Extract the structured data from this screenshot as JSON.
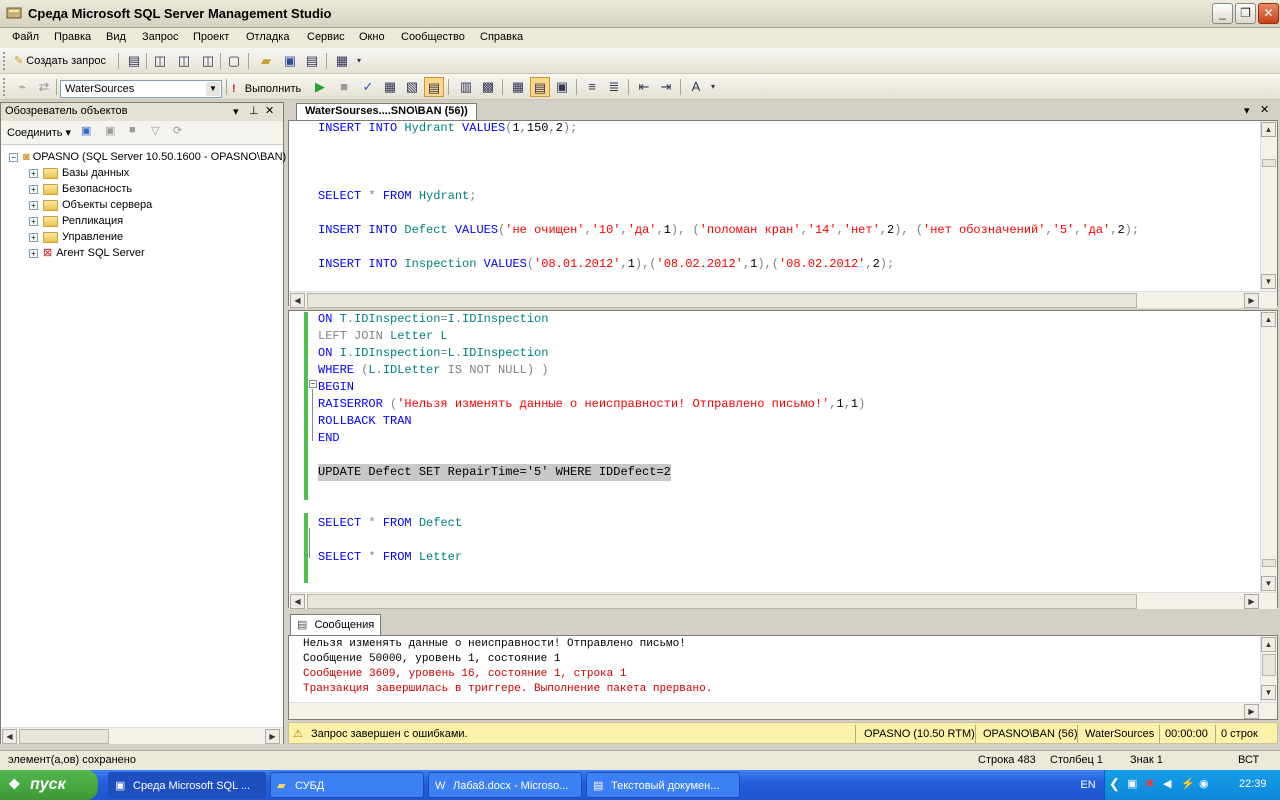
{
  "window": {
    "title": "Среда Microsoft SQL Server Management Studio"
  },
  "menu": [
    "Файл",
    "Правка",
    "Вид",
    "Запрос",
    "Проект",
    "Отладка",
    "Сервис",
    "Окно",
    "Сообщество",
    "Справка"
  ],
  "toolbar1": {
    "create_query": "Создать запрос"
  },
  "toolbar2": {
    "database": "WaterSources",
    "execute": "Выполнить"
  },
  "object_explorer": {
    "title": "Обозреватель объектов",
    "connect": "Соединить",
    "root": "OPASNO (SQL Server 10.50.1600 - OPASNO\\BAN)",
    "nodes": [
      "Базы данных",
      "Безопасность",
      "Объекты сервера",
      "Репликация",
      "Управление",
      "Агент SQL Server"
    ]
  },
  "editor": {
    "tab_title": "WaterSourses....SNO\\BAN (56))"
  },
  "messages": {
    "tab": "Сообщения",
    "lines": [
      "Нельзя изменять данные о неисправности! Отправлено письмо!",
      "Сообщение 50000, уровень 1, состояние 1",
      "Сообщение 3609, уровень 16, состояние 1, строка 1",
      "Транзакция завершилась в триггере. Выполнение пакета прервано."
    ],
    "error_color": "#cc0000"
  },
  "query_status": {
    "text": "Запрос завершен с ошибками.",
    "server": "OPASNO (10.50 RTM)",
    "user": "OPASNO\\BAN (56)",
    "database": "WaterSources",
    "elapsed": "00:00:00",
    "rows": "0 строк"
  },
  "statusbar": {
    "left": "элемент(а,ов) сохранено",
    "line": "Строка 483",
    "col": "Столбец 1",
    "ch": "Знак 1",
    "mode": "ВСТ"
  },
  "taskbar": {
    "start": "пуск",
    "tasks": [
      "Среда Microsoft SQL ...",
      "СУБД",
      "Лаба8.docx - Microso...",
      "Текстовый докумен..."
    ],
    "lang": "EN",
    "clock": "22:39"
  }
}
